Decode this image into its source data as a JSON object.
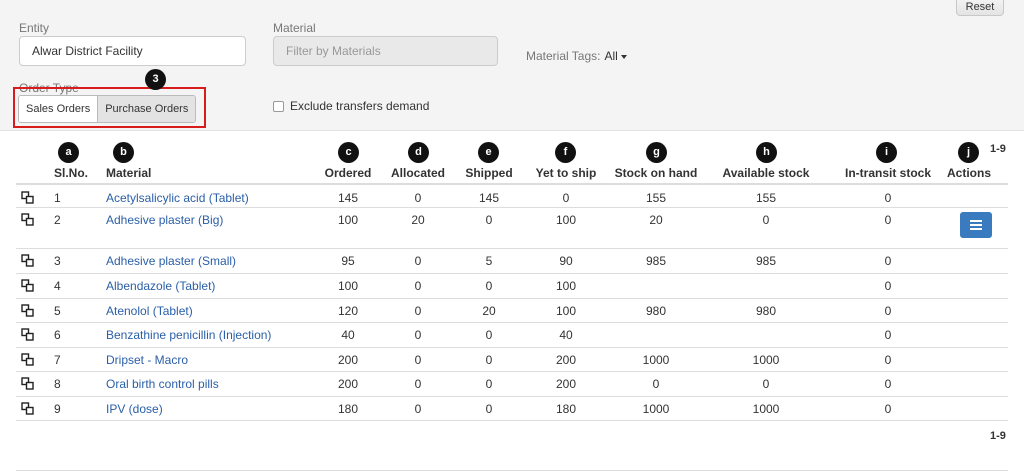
{
  "filters": {
    "entity_label": "Entity",
    "entity_value": "Alwar District Facility",
    "material_label": "Material",
    "material_placeholder": "Filter by Materials",
    "material_tags_label": "Material Tags:",
    "material_tags_value": "All",
    "order_type_label": "Order Type",
    "order_types": [
      "Sales Orders",
      "Purchase Orders"
    ],
    "exclude_label": "Exclude transfers demand",
    "reset_label": "Reset"
  },
  "badges": [
    "a",
    "b",
    "c",
    "d",
    "e",
    "f",
    "g",
    "h",
    "i",
    "j",
    "3"
  ],
  "pagination": {
    "top": "1-9",
    "bottom": "1-9"
  },
  "table": {
    "headers": [
      "Sl.No.",
      "Material",
      "Ordered",
      "Allocated",
      "Shipped",
      "Yet to ship",
      "Stock on hand",
      "Available stock",
      "In-transit stock",
      "Actions"
    ],
    "rows": [
      {
        "sl": "1",
        "material": "Acetylsalicylic acid (Tablet)",
        "ordered": "145",
        "allocated": "0",
        "shipped": "145",
        "yet": "0",
        "onhand": "155",
        "available": "155",
        "transit": "0"
      },
      {
        "sl": "2",
        "material": "Adhesive plaster (Big)",
        "ordered": "100",
        "allocated": "20",
        "shipped": "0",
        "yet": "100",
        "onhand": "20",
        "available": "0",
        "transit": "0"
      },
      {
        "sl": "3",
        "material": "Adhesive plaster (Small)",
        "ordered": "95",
        "allocated": "0",
        "shipped": "5",
        "yet": "90",
        "onhand": "985",
        "available": "985",
        "transit": "0"
      },
      {
        "sl": "4",
        "material": "Albendazole (Tablet)",
        "ordered": "100",
        "allocated": "0",
        "shipped": "0",
        "yet": "100",
        "onhand": "",
        "available": "",
        "transit": "0"
      },
      {
        "sl": "5",
        "material": "Atenolol (Tablet)",
        "ordered": "120",
        "allocated": "0",
        "shipped": "20",
        "yet": "100",
        "onhand": "980",
        "available": "980",
        "transit": "0"
      },
      {
        "sl": "6",
        "material": "Benzathine penicillin (Injection)",
        "ordered": "40",
        "allocated": "0",
        "shipped": "0",
        "yet": "40",
        "onhand": "",
        "available": "",
        "transit": "0"
      },
      {
        "sl": "7",
        "material": "Dripset - Macro",
        "ordered": "200",
        "allocated": "0",
        "shipped": "0",
        "yet": "200",
        "onhand": "1000",
        "available": "1000",
        "transit": "0"
      },
      {
        "sl": "8",
        "material": "Oral birth control pills",
        "ordered": "200",
        "allocated": "0",
        "shipped": "0",
        "yet": "200",
        "onhand": "0",
        "available": "0",
        "transit": "0"
      },
      {
        "sl": "9",
        "material": "IPV (dose)",
        "ordered": "180",
        "allocated": "0",
        "shipped": "0",
        "yet": "180",
        "onhand": "1000",
        "available": "1000",
        "transit": "0"
      }
    ]
  },
  "icons": {
    "copy": "copy-icon",
    "actions": "menu-icon"
  },
  "colors": {
    "link": "#2a5fa8",
    "action_button": "#3a7bbf",
    "highlight": "#d81b1b"
  }
}
